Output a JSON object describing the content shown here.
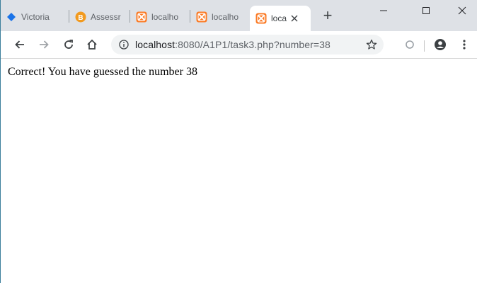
{
  "tabs": [
    {
      "label": "Victoria",
      "icon": "diamond-icon",
      "active": false
    },
    {
      "label": "Assessr",
      "icon": "b-logo-icon",
      "active": false
    },
    {
      "label": "localho",
      "icon": "xampp-icon",
      "active": false
    },
    {
      "label": "localho",
      "icon": "xampp-icon",
      "active": false
    },
    {
      "label": "loca",
      "icon": "xampp-icon",
      "active": true
    }
  ],
  "new_tab_label": "+",
  "toolbar": {
    "url_host": "localhost",
    "url_path": ":8080/A1P1/task3.php?number=38"
  },
  "page": {
    "message": "Correct! You have guessed the number 38"
  },
  "colors": {
    "tabstrip_bg": "#dee1e6",
    "omnibox_bg": "#f1f3f4",
    "xampp_orange": "#fb7a24",
    "diamond_blue": "#1a73e8",
    "b_logo_orange": "#f29a1f"
  }
}
